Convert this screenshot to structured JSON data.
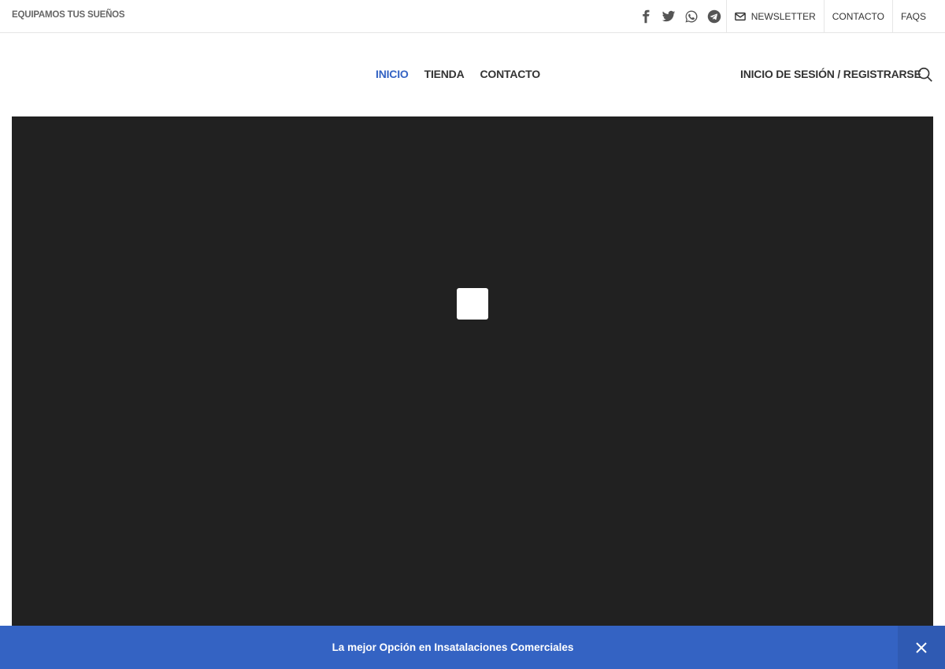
{
  "topbar": {
    "tagline": "EQUIPAMOS TUS SUEÑOS",
    "social_icons": [
      "facebook-icon",
      "twitter-icon",
      "whatsapp-icon",
      "telegram-icon"
    ],
    "links": {
      "newsletter": "NEWSLETTER",
      "contacto": "CONTACTO",
      "faqs": "FAQS"
    }
  },
  "nav": {
    "items": [
      {
        "label": "INICIO",
        "active": true
      },
      {
        "label": "TIENDA",
        "active": false
      },
      {
        "label": "CONTACTO",
        "active": false
      }
    ],
    "login": "INICIO DE SESIÓN / REGISTRARSE",
    "search_icon": "search-icon"
  },
  "hero": {
    "stop_icon": "stop-icon"
  },
  "banner": {
    "message": "La mejor Opción en Insatalaciones Comerciales",
    "close_icon": "close-icon"
  },
  "colors": {
    "accent": "#3463c3",
    "hero_bg": "#212121",
    "text": "#333333"
  }
}
